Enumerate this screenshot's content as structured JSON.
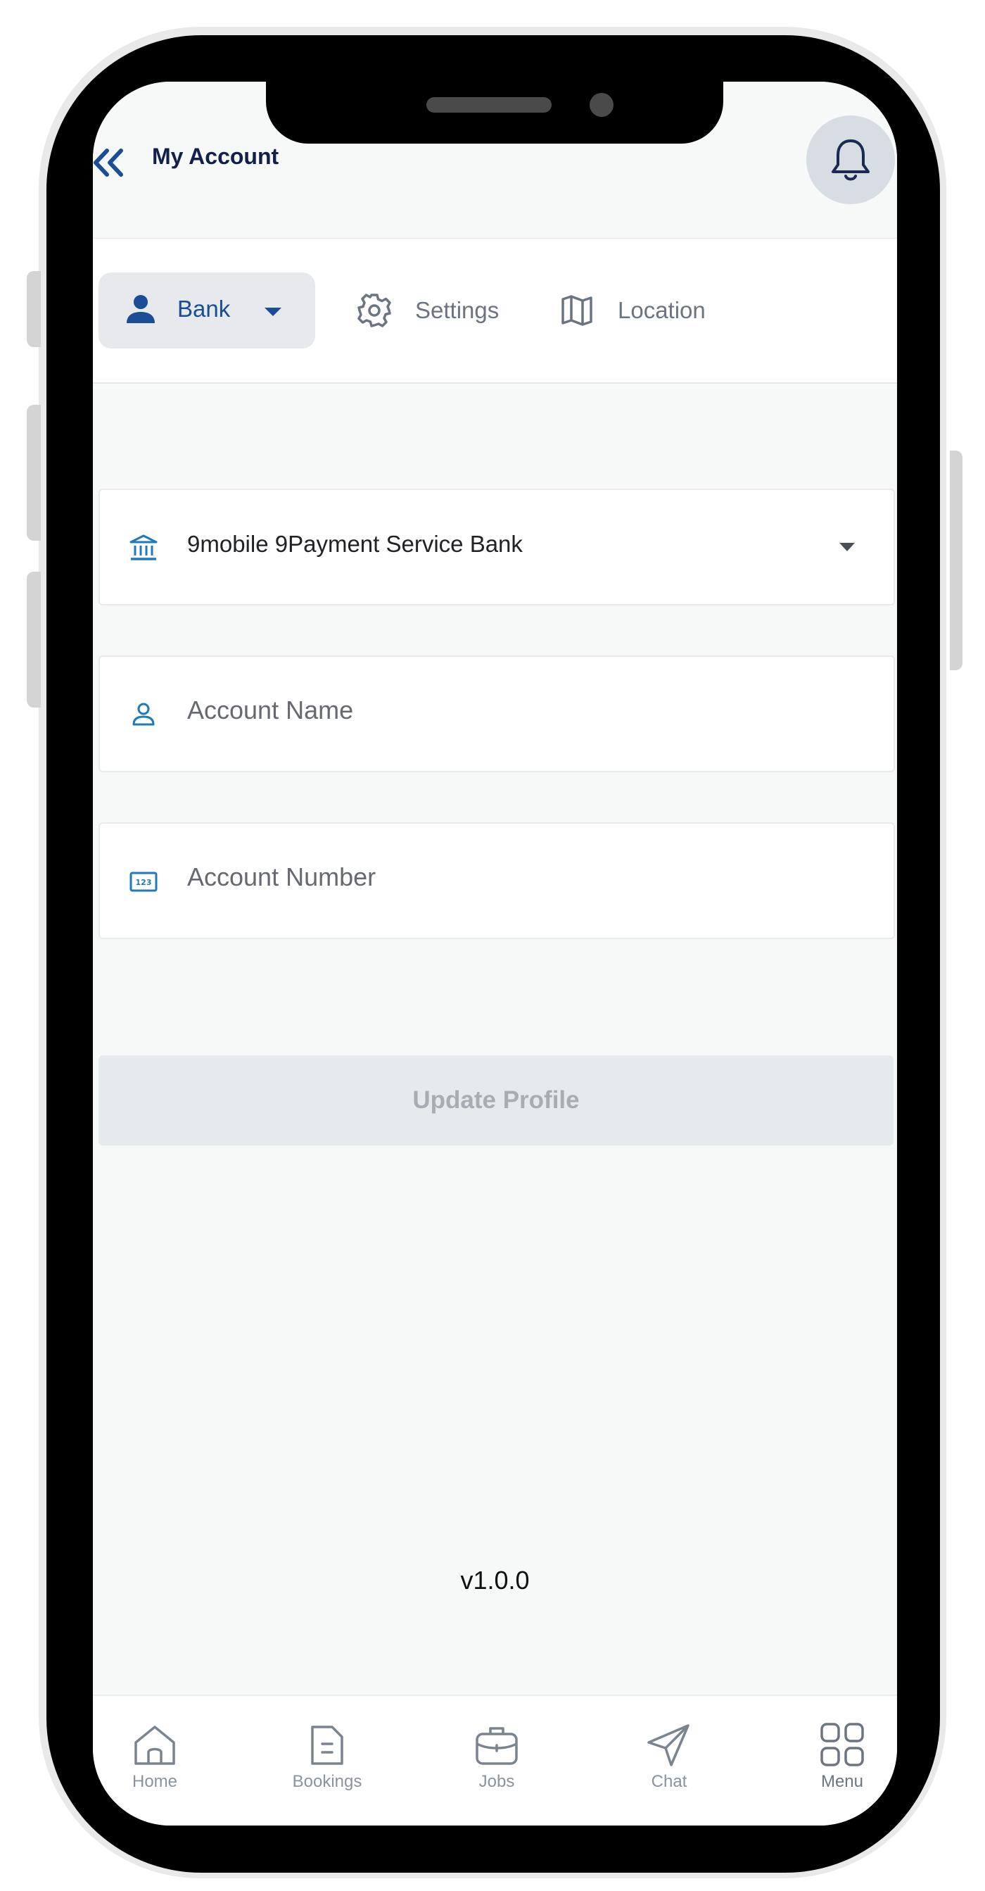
{
  "header": {
    "title": "My Account"
  },
  "tabs": [
    {
      "label": "Bank",
      "icon": "person-icon",
      "active": true
    },
    {
      "label": "Settings",
      "icon": "gear-icon",
      "active": false
    },
    {
      "label": "Location",
      "icon": "map-icon",
      "active": false
    }
  ],
  "form": {
    "bank_select_value": "9mobile 9Payment Service Bank",
    "account_name_placeholder": "Account Name",
    "account_number_placeholder": "Account Number",
    "submit_label": "Update Profile"
  },
  "version": "v1.0.0",
  "bottom_nav": [
    {
      "label": "Home",
      "icon": "home-icon"
    },
    {
      "label": "Bookings",
      "icon": "document-icon"
    },
    {
      "label": "Jobs",
      "icon": "briefcase-icon"
    },
    {
      "label": "Chat",
      "icon": "send-icon"
    },
    {
      "label": "Menu",
      "icon": "grid-icon"
    }
  ],
  "colors": {
    "primary": "#1a4d96",
    "title": "#13204a",
    "field_icon": "#1f7ab8",
    "disabled_button_bg": "#e7eaed",
    "disabled_button_text": "#a9adb3"
  }
}
